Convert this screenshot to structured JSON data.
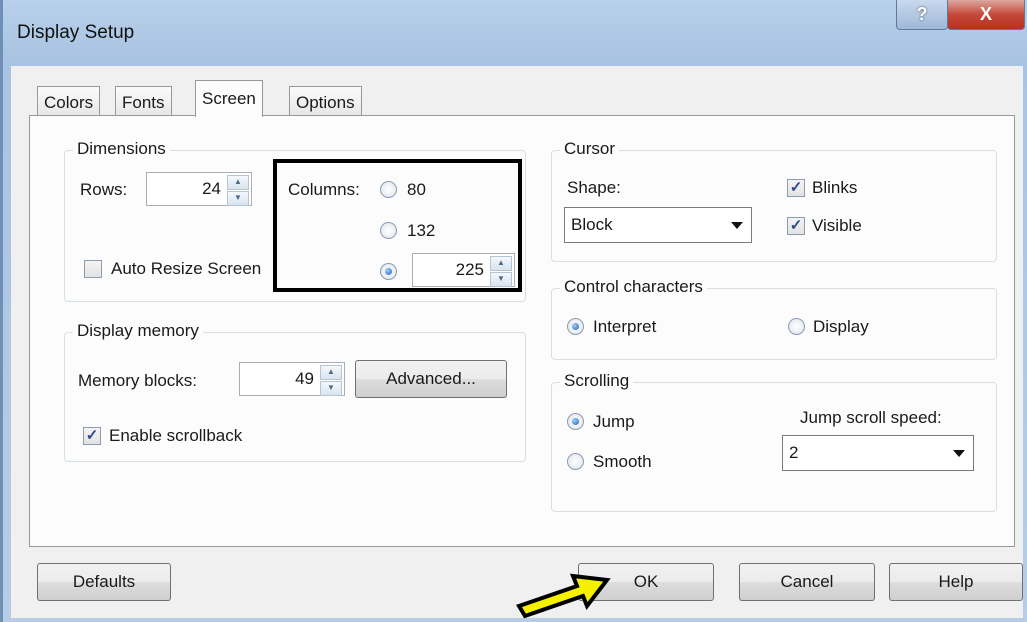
{
  "window": {
    "title": "Display Setup",
    "help_glyph": "?",
    "close_glyph": "X"
  },
  "tabs": [
    {
      "label": "Colors"
    },
    {
      "label": "Fonts"
    },
    {
      "label": "Screen"
    },
    {
      "label": "Options"
    }
  ],
  "dimensions": {
    "group_label": "Dimensions",
    "rows_label": "Rows:",
    "rows_value": "24",
    "columns_label": "Columns:",
    "columns_options": [
      "80",
      "132"
    ],
    "columns_custom_value": "225",
    "columns_selected": "custom",
    "auto_resize_label": "Auto Resize Screen",
    "auto_resize_checked": false
  },
  "display_memory": {
    "group_label": "Display memory",
    "memory_blocks_label": "Memory blocks:",
    "memory_blocks_value": "49",
    "advanced_label": "Advanced...",
    "enable_scrollback_label": "Enable scrollback",
    "enable_scrollback_checked": true
  },
  "cursor": {
    "group_label": "Cursor",
    "shape_label": "Shape:",
    "shape_value": "Block",
    "blinks_label": "Blinks",
    "blinks_checked": true,
    "visible_label": "Visible",
    "visible_checked": true
  },
  "control_characters": {
    "group_label": "Control characters",
    "interpret_label": "Interpret",
    "display_label": "Display",
    "selected": "Interpret"
  },
  "scrolling": {
    "group_label": "Scrolling",
    "jump_label": "Jump",
    "smooth_label": "Smooth",
    "selected": "Jump",
    "speed_label": "Jump scroll speed:",
    "speed_value": "2"
  },
  "buttons": {
    "defaults": "Defaults",
    "ok": "OK",
    "cancel": "Cancel",
    "help": "Help"
  },
  "colors": {
    "annotation_arrow": "#f5f000",
    "annotation_box": "#000000",
    "close_button": "#c5493a"
  }
}
